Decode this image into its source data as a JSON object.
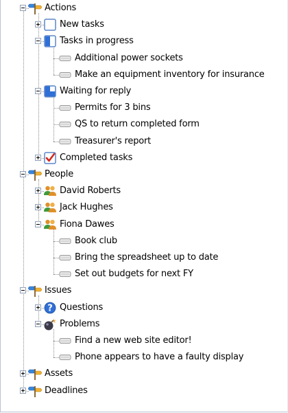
{
  "tree": [
    {
      "label": "Actions",
      "icon": "folder-signpost-icon",
      "expanded": true,
      "children": [
        {
          "label": "New tasks",
          "icon": "empty-box-icon",
          "expanded": false,
          "children": []
        },
        {
          "label": "Tasks in progress",
          "icon": "half-filled-box-icon",
          "expanded": true,
          "children": [
            {
              "label": "Additional power sockets",
              "icon": "task-icon"
            },
            {
              "label": "Make an equipment inventory for insurance",
              "icon": "task-icon"
            }
          ]
        },
        {
          "label": "Waiting for reply",
          "icon": "quarter-filled-box-icon",
          "expanded": true,
          "children": [
            {
              "label": "Permits for 3 bins",
              "icon": "task-icon"
            },
            {
              "label": "QS to return completed form",
              "icon": "task-icon"
            },
            {
              "label": "Treasurer's report",
              "icon": "task-icon"
            }
          ]
        },
        {
          "label": "Completed tasks",
          "icon": "checked-box-icon",
          "expanded": false,
          "children": []
        }
      ]
    },
    {
      "label": "People",
      "icon": "folder-signpost-icon",
      "expanded": true,
      "children": [
        {
          "label": "David Roberts",
          "icon": "people-icon",
          "expanded": false,
          "children": []
        },
        {
          "label": "Jack Hughes",
          "icon": "people-icon",
          "expanded": false,
          "children": []
        },
        {
          "label": "Fiona Dawes",
          "icon": "people-icon",
          "expanded": true,
          "children": [
            {
              "label": "Book club",
              "icon": "task-icon"
            },
            {
              "label": "Bring the spreadsheet up to date",
              "icon": "task-icon"
            },
            {
              "label": "Set out budgets for next FY",
              "icon": "task-icon"
            }
          ]
        }
      ]
    },
    {
      "label": "Issues",
      "icon": "folder-signpost-icon",
      "expanded": true,
      "children": [
        {
          "label": "Questions",
          "icon": "question-icon",
          "expanded": false,
          "children": []
        },
        {
          "label": "Problems",
          "icon": "bomb-icon",
          "expanded": true,
          "children": [
            {
              "label": "Find a new web site editor!",
              "icon": "task-icon"
            },
            {
              "label": "Phone appears to have a faulty display",
              "icon": "task-icon"
            }
          ]
        }
      ]
    },
    {
      "label": "Assets",
      "icon": "folder-signpost-icon",
      "expanded": false,
      "children": []
    },
    {
      "label": "Deadlines",
      "icon": "folder-signpost-icon",
      "expanded": false,
      "children": []
    }
  ],
  "colors": {
    "accent_blue": "#2f6fd6",
    "box_border": "#5b86c8",
    "signpost_yellow": "#f2b233",
    "signpost_blue": "#3b86d9",
    "check_red": "#d2281e",
    "people_orange": "#e0902a",
    "people_green": "#3f9a3a",
    "task_gray": "#9a9a9a",
    "tree_line": "#8a8a8a"
  }
}
